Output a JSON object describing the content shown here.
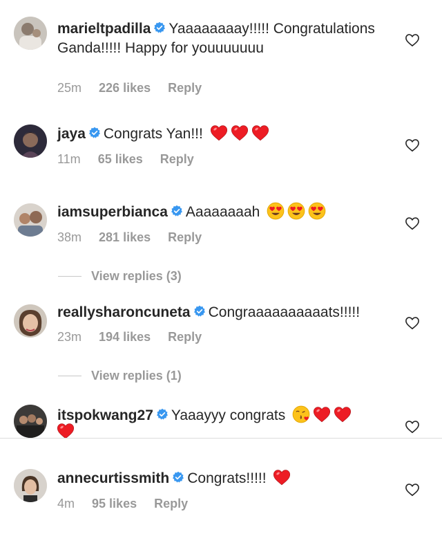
{
  "colors": {
    "text": "#262626",
    "meta": "#999999",
    "verified": "#3897f0",
    "heart": "#ed1c24"
  },
  "comments": [
    {
      "username": "marieltpadilla",
      "text": "Yaaaaaaaay!!!!! Congratulations Ganda!!!!! Happy for youuuuuuu",
      "time": "25m",
      "likes": "226 likes",
      "reply": "Reply"
    },
    {
      "username": "jaya",
      "text": "Congrats Yan!!!",
      "emojis": [
        "red-heart",
        "red-heart",
        "red-heart"
      ],
      "time": "11m",
      "likes": "65 likes",
      "reply": "Reply"
    },
    {
      "username": "iamsuperbianca",
      "text": "Aaaaaaaah",
      "emojis": [
        "heart-eyes",
        "heart-eyes",
        "heart-eyes"
      ],
      "time": "38m",
      "likes": "281 likes",
      "reply": "Reply",
      "view_replies": "View replies (3)"
    },
    {
      "username": "reallysharoncuneta",
      "text": "Congraaaaaaaaaats!!!!!",
      "time": "23m",
      "likes": "194 likes",
      "reply": "Reply",
      "view_replies": "View replies (1)"
    },
    {
      "username": "itspokwang27",
      "text": "Yaaayyy congrats",
      "emojis": [
        "kissing-heart",
        "red-heart",
        "red-heart",
        "red-heart"
      ]
    },
    {
      "username": "annecurtissmith",
      "text": "Congrats!!!!!",
      "emojis": [
        "red-heart"
      ],
      "time": "4m",
      "likes": "95 likes",
      "reply": "Reply"
    }
  ]
}
